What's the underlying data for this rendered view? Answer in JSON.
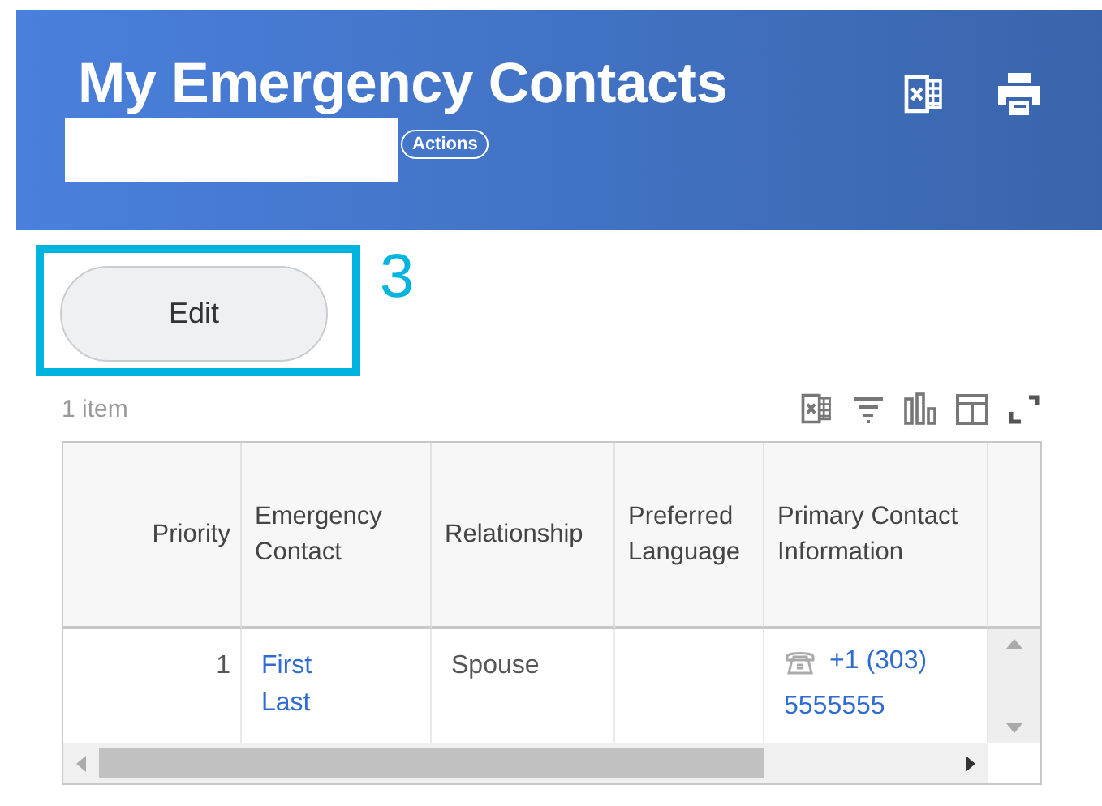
{
  "header": {
    "title": "My Emergency Contacts",
    "actions_button": "Actions"
  },
  "edit_button": {
    "label": "Edit",
    "highlighted": true,
    "annotation": "3"
  },
  "item_count": "1 item",
  "table": {
    "columns": [
      {
        "label": "Priority",
        "kind": "number"
      },
      {
        "label": "Emergency Contact",
        "kind": "text"
      },
      {
        "label": "Relationship",
        "kind": "text"
      },
      {
        "label": "Preferred Language",
        "kind": "text"
      },
      {
        "label": "Primary Contact Information",
        "kind": "text"
      }
    ],
    "rows": [
      [
        {
          "kind": "text",
          "text": "1"
        },
        {
          "kind": "link",
          "text": "First Last"
        },
        {
          "kind": "text",
          "text": "Spouse"
        },
        {
          "kind": "empty"
        },
        {
          "kind": "phone",
          "lines": [
            "+1 (303)",
            "5555555"
          ]
        }
      ]
    ]
  }
}
